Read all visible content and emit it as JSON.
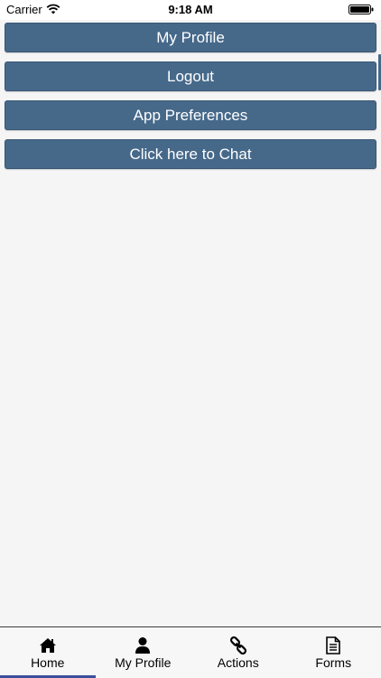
{
  "status_bar": {
    "carrier": "Carrier",
    "time": "9:18 AM"
  },
  "menu": {
    "buttons": [
      {
        "label": "My Profile"
      },
      {
        "label": "Logout"
      },
      {
        "label": "App Preferences"
      },
      {
        "label": "Click here to Chat"
      }
    ],
    "button_color": "#46698a"
  },
  "tab_bar": {
    "tabs": [
      {
        "label": "Home",
        "icon": "home-icon",
        "selected": true
      },
      {
        "label": "My Profile",
        "icon": "user-icon",
        "selected": false
      },
      {
        "label": "Actions",
        "icon": "link-icon",
        "selected": false
      },
      {
        "label": "Forms",
        "icon": "document-icon",
        "selected": false
      }
    ],
    "indicator_color": "#3a4f9a"
  }
}
